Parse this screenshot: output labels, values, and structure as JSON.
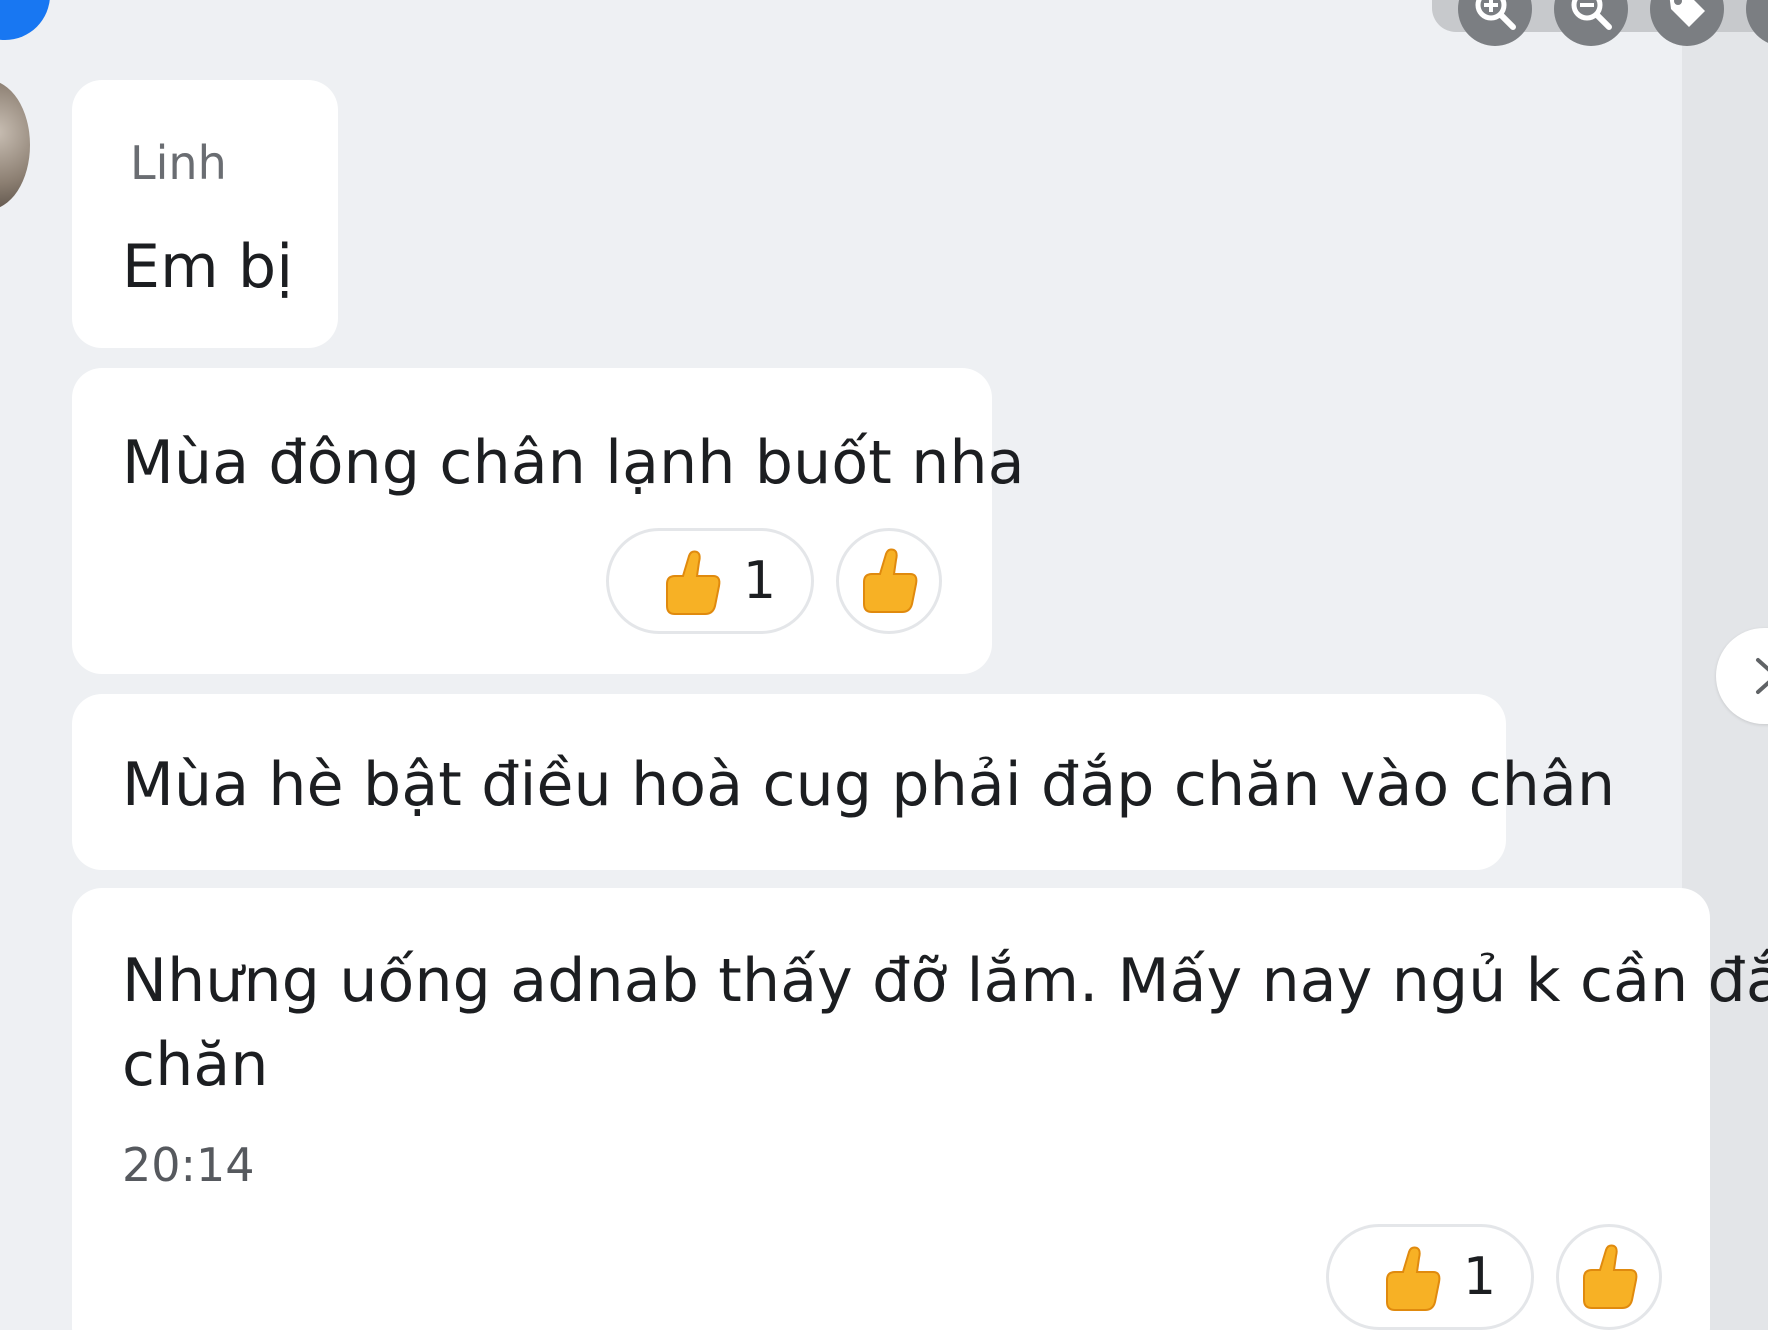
{
  "messages": [
    {
      "sender": "Linh",
      "text": "Em bị"
    },
    {
      "text": "Mùa đông chân lạnh buốt nha",
      "reaction": {
        "icon": "thumbs-up-icon",
        "count": "1"
      }
    },
    {
      "text": "Mùa hè bật điều hoà cug phải đắp chăn vào chân"
    },
    {
      "text_line1": "Nhưng uống adnab thấy đỡ lắm. Mấy nay ngủ k cần đắp",
      "text_line2": "chăn",
      "time": "20:14",
      "reaction": {
        "icon": "thumbs-up-icon",
        "count": "1"
      }
    }
  ],
  "toolbar": {
    "icons": [
      "zoom-in-icon",
      "zoom-out-icon",
      "tag-icon"
    ]
  },
  "navigation": {
    "next_icon": "chevron-right-icon"
  },
  "colors": {
    "background": "#eef0f3",
    "bubble": "#ffffff",
    "text": "#1c1e21",
    "secondary_text": "#6a6d72",
    "reaction": "#f7b125",
    "brand": "#1877f2",
    "toolbar_button": "#7b7e82"
  }
}
